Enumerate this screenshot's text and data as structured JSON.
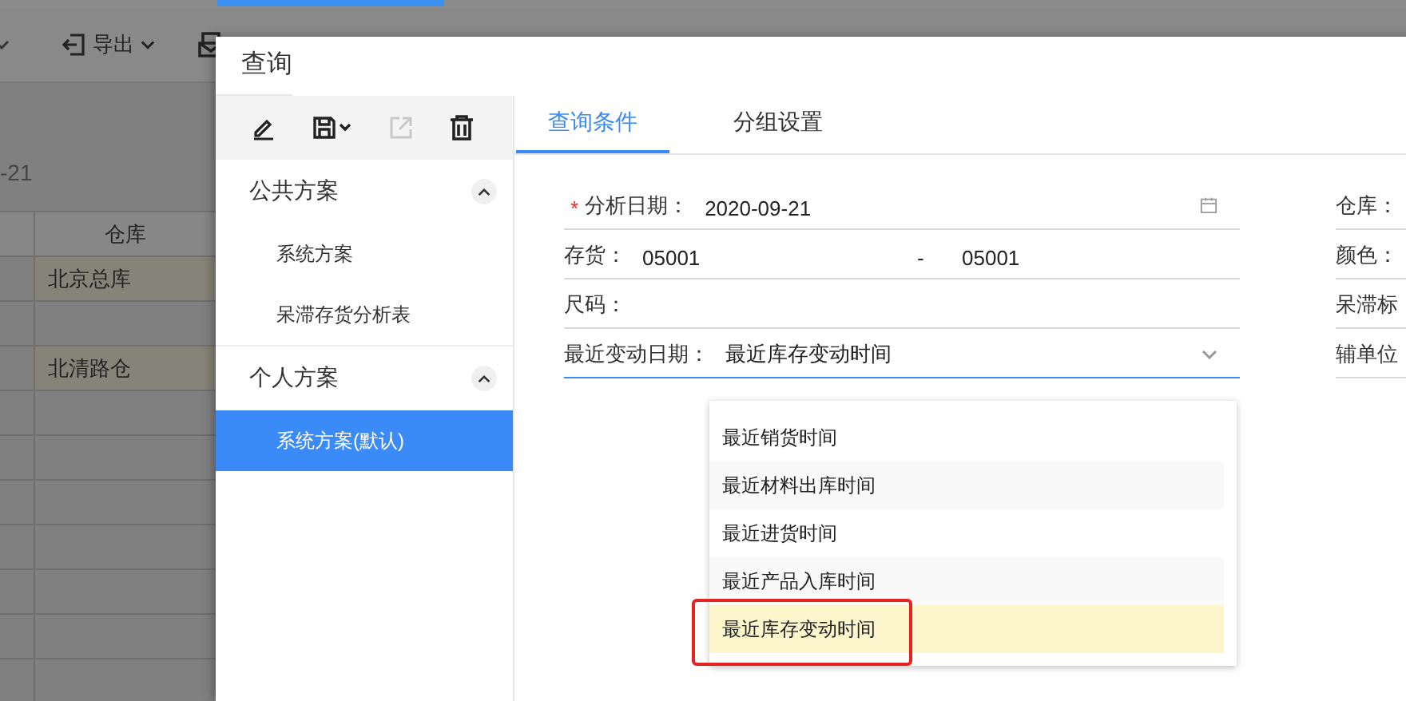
{
  "background": {
    "toolbar": [
      {
        "label": "导出",
        "kind": "dropdown"
      }
    ],
    "date_fragment": "-21",
    "table": {
      "columns": [
        "仓库"
      ],
      "rows": [
        {
          "warehouse": "北京总库"
        },
        {
          "warehouse": null
        },
        {
          "warehouse": "北清路仓"
        },
        {
          "warehouse": null
        },
        {
          "warehouse": null
        },
        {
          "warehouse": null
        },
        {
          "warehouse": null
        },
        {
          "warehouse": null
        },
        {
          "warehouse": null
        },
        {
          "warehouse": null
        }
      ]
    }
  },
  "dialog": {
    "title": "查询",
    "sidebar": {
      "tools": [
        {
          "kind": "edit",
          "disabled": false
        },
        {
          "kind": "save",
          "disabled": false
        },
        {
          "kind": "share",
          "disabled": true
        },
        {
          "kind": "delete",
          "disabled": false
        }
      ],
      "groups": [
        {
          "label": "公共方案",
          "expanded": true,
          "items": [
            {
              "label": "系统方案",
              "selected": false
            },
            {
              "label": "呆滞存货分析表",
              "selected": false
            }
          ]
        },
        {
          "label": "个人方案",
          "expanded": true,
          "items": [
            {
              "label": "系统方案(默认)",
              "selected": true
            }
          ]
        }
      ]
    },
    "tabs": [
      {
        "label": "查询条件",
        "selected": true
      },
      {
        "label": "分组设置",
        "selected": false
      }
    ],
    "fields": [
      {
        "kind": "date",
        "label": "分析日期：",
        "required_mark": "*",
        "value": "2020-09-21"
      },
      {
        "kind": "range",
        "label": "存货：",
        "value": "05001",
        "separator": "-",
        "value_to": "05001"
      },
      {
        "kind": "text",
        "label": "尺码："
      },
      {
        "kind": "select",
        "label": "最近变动日期：",
        "value": "最近库存变动时间",
        "expanded": true
      }
    ],
    "right_fields": [
      {
        "label": "仓库："
      },
      {
        "label": "颜色："
      },
      {
        "label": "呆滞标"
      },
      {
        "label": "辅单位"
      }
    ],
    "dropdown_options": [
      {
        "label": "最近销货时间",
        "selected": false,
        "annotated": false
      },
      {
        "label": "最近材料出库时间",
        "selected": false,
        "annotated": false
      },
      {
        "label": "最近进货时间",
        "selected": false,
        "annotated": false
      },
      {
        "label": "最近产品入库时间",
        "selected": false,
        "annotated": false
      },
      {
        "label": "最近库存变动时间",
        "selected": true,
        "annotated": true
      }
    ]
  }
}
